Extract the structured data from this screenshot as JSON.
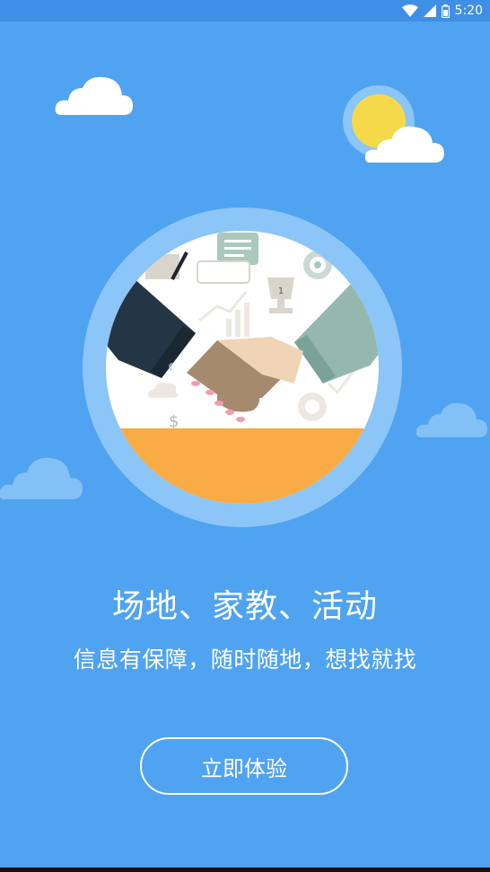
{
  "status_bar": {
    "time": "5:20",
    "icons": [
      "wifi-icon",
      "cell-signal-icon",
      "battery-icon"
    ]
  },
  "hero": {
    "illustration": "handshake-illustration"
  },
  "headline": "场地、家教、活动",
  "subline": "信息有保障，随时随地，想找就找",
  "cta": {
    "label": "立即体验"
  },
  "colors": {
    "background": "#4fa3f1",
    "status_bar": "#3f8fe6",
    "hero_ring": "#8cc5f7",
    "table": "#f9ab45",
    "sun": "#f6d94a"
  }
}
